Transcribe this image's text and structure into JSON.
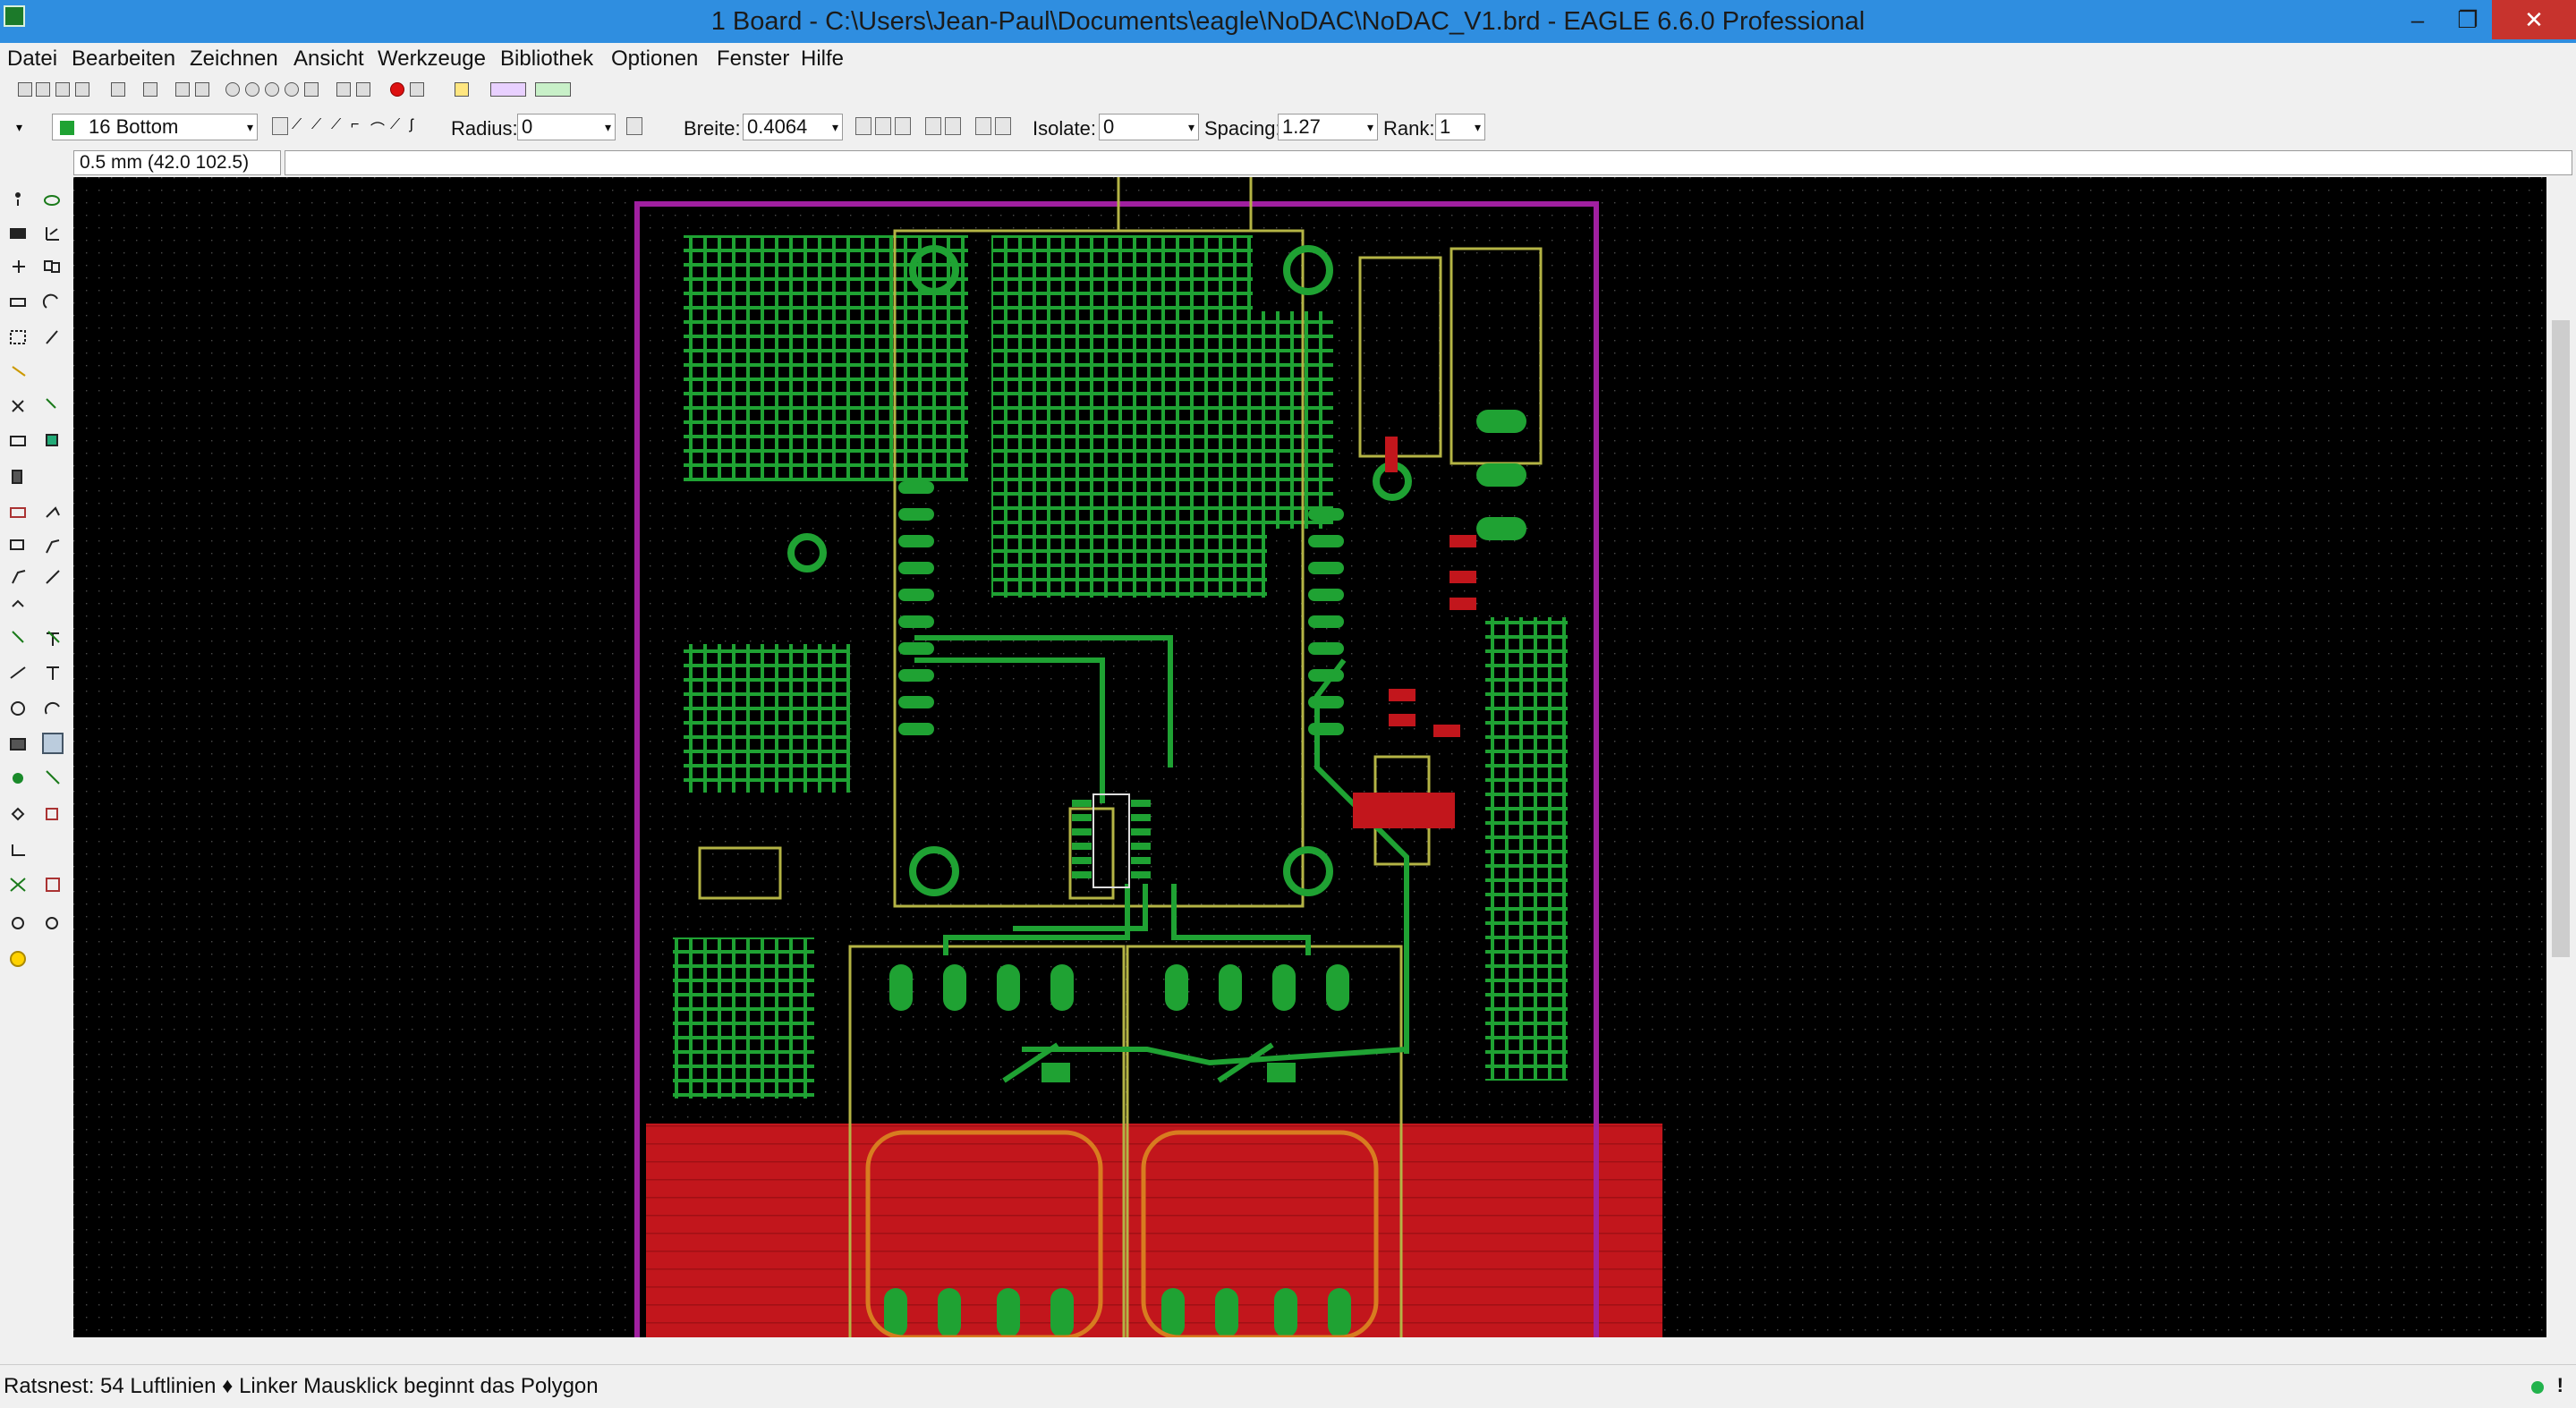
{
  "window": {
    "title": "1 Board - C:\\Users\\Jean-Paul\\Documents\\eagle\\NoDAC\\NoDAC_V1.brd - EAGLE 6.6.0 Professional",
    "minimize": "–",
    "maximize": "❐",
    "close": "✕"
  },
  "menu": [
    "Datei",
    "Bearbeiten",
    "Zeichnen",
    "Ansicht",
    "Werkzeuge",
    "Bibliothek",
    "Optionen",
    "Fenster",
    "Hilfe"
  ],
  "params": {
    "layer": "16 Bottom",
    "radius_label": "Radius:",
    "radius_value": "0",
    "width_label": "Breite:",
    "width_value": "0.4064",
    "isolate_label": "Isolate:",
    "isolate_value": "0",
    "spacing_label": "Spacing:",
    "spacing_value": "1.27",
    "rank_label": "Rank:",
    "rank_value": "1",
    "dropdown_glyph": "▾"
  },
  "command": {
    "coordinates": "0.5 mm (42.0 102.5)",
    "input_value": ""
  },
  "status": {
    "message": "Ratsnest: 54 Luftlinien  ♦ Linker Mausklick beginnt das Polygon",
    "indicator": "!"
  },
  "colors": {
    "canvas": "#000000",
    "board_outline": "#a020a0",
    "top_copper": "#1fa233",
    "bottom_copper": "#c2161c",
    "silkscreen": "#b4b445",
    "titlebar": "#2f8ee0"
  },
  "icons": {
    "app": "eagle-app-icon",
    "status_led": "green-status-led"
  }
}
